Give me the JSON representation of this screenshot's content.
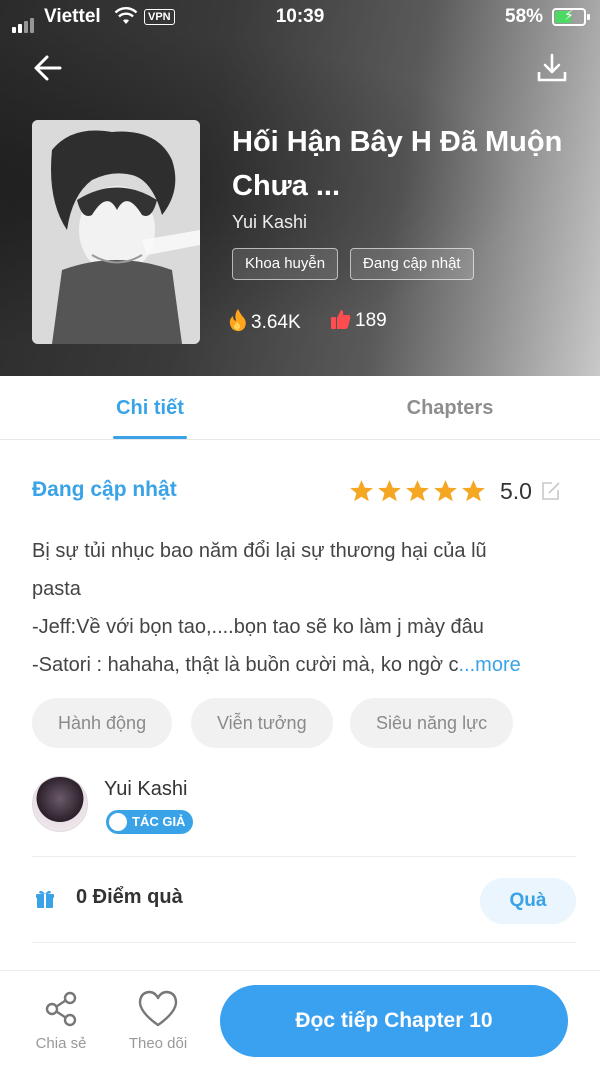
{
  "status_bar": {
    "carrier": "Viettel",
    "vpn": "VPN",
    "time": "10:39",
    "battery_pct": "58%",
    "battery_level": 0.58
  },
  "header": {
    "title": "Hối Hận Bây H Đã Muộn Chưa ...",
    "author": "Yui Kashi",
    "tags": [
      "Khoa huyễn",
      "Đang cập nhật"
    ],
    "views": "3.64K",
    "likes": "189"
  },
  "tabs": {
    "detail": "Chi tiết",
    "chapters": "Chapters"
  },
  "detail": {
    "status": "Đang cập nhật",
    "rating": "5.0",
    "stars": 5,
    "description_lines": [
      "Bị sự tủi nhục bao năm đổi lại sự thương hại của lũ",
      "pasta",
      "-Jeff:Về với bọn tao,....bọn tao sẽ ko làm j mày đâu",
      "-Satori : hahaha, thật là buồn cười mà, ko ngờ c"
    ],
    "more_label": "...more",
    "genres": [
      "Hành động",
      "Viễn tưởng",
      "Siêu năng lực"
    ]
  },
  "author": {
    "name": "Yui Kashi",
    "badge": "TÁC GIẢ"
  },
  "gift": {
    "points_label": "0 Điểm quà",
    "button_label": "Quà"
  },
  "bottom_bar": {
    "share_label": "Chia sẻ",
    "follow_label": "Theo dõi",
    "read_label": "Đọc tiếp Chapter 10"
  },
  "colors": {
    "accent": "#3aa3e8",
    "star": "#f5a623"
  }
}
